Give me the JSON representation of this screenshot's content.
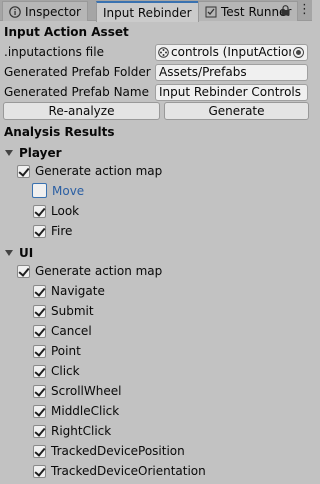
{
  "tabs": [
    {
      "label": "Inspector",
      "icon": "info-icon"
    },
    {
      "label": "Input Rebinder",
      "icon": "gamepad-icon"
    },
    {
      "label": "Test Runner",
      "icon": "checklist-icon"
    }
  ],
  "section_title": "Input Action Asset",
  "fields": {
    "inputactions_label": ".inputactions file",
    "inputactions_value": "controls (InputActionAsset)",
    "prefab_folder_label": "Generated Prefab Folder",
    "prefab_folder_value": "Assets/Prefabs",
    "prefab_name_label": "Generated Prefab Name",
    "prefab_name_value": "Input Rebinder Controls"
  },
  "buttons": {
    "reanalyze": "Re-analyze",
    "generate": "Generate"
  },
  "results_title": "Analysis Results",
  "maps": [
    {
      "name": "Player",
      "generate_label": "Generate action map",
      "generate_checked": true,
      "actions": [
        {
          "name": "Move",
          "checked": false,
          "focused": true
        },
        {
          "name": "Look",
          "checked": true
        },
        {
          "name": "Fire",
          "checked": true
        }
      ]
    },
    {
      "name": "UI",
      "generate_label": "Generate action map",
      "generate_checked": true,
      "actions": [
        {
          "name": "Navigate",
          "checked": true
        },
        {
          "name": "Submit",
          "checked": true
        },
        {
          "name": "Cancel",
          "checked": true
        },
        {
          "name": "Point",
          "checked": true
        },
        {
          "name": "Click",
          "checked": true
        },
        {
          "name": "ScrollWheel",
          "checked": true
        },
        {
          "name": "MiddleClick",
          "checked": true
        },
        {
          "name": "RightClick",
          "checked": true
        },
        {
          "name": "TrackedDevicePosition",
          "checked": true
        },
        {
          "name": "TrackedDeviceOrientation",
          "checked": true
        }
      ]
    }
  ]
}
